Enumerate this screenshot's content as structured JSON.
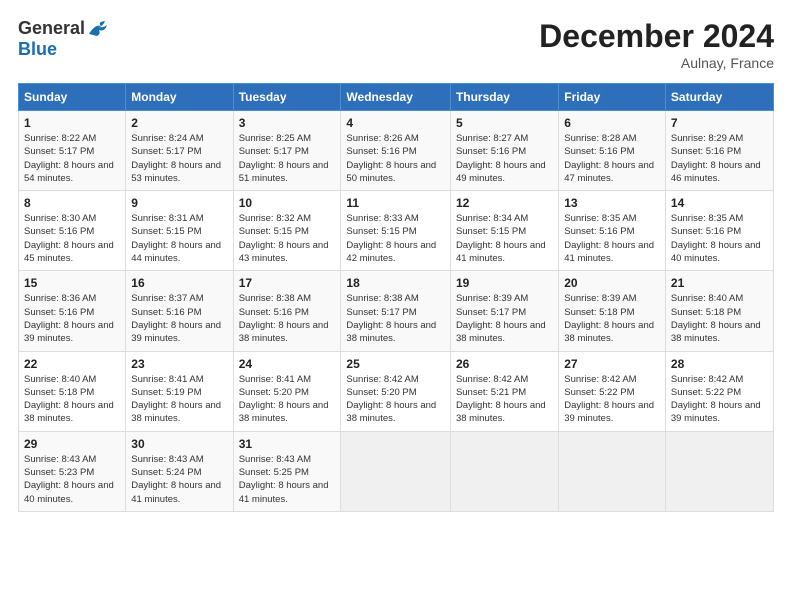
{
  "header": {
    "logo_general": "General",
    "logo_blue": "Blue",
    "title": "December 2024",
    "location": "Aulnay, France"
  },
  "calendar": {
    "days_of_week": [
      "Sunday",
      "Monday",
      "Tuesday",
      "Wednesday",
      "Thursday",
      "Friday",
      "Saturday"
    ],
    "weeks": [
      [
        {
          "day": "1",
          "sunrise": "8:22 AM",
          "sunset": "5:17 PM",
          "daylight": "8 hours and 54 minutes."
        },
        {
          "day": "2",
          "sunrise": "8:24 AM",
          "sunset": "5:17 PM",
          "daylight": "8 hours and 53 minutes."
        },
        {
          "day": "3",
          "sunrise": "8:25 AM",
          "sunset": "5:17 PM",
          "daylight": "8 hours and 51 minutes."
        },
        {
          "day": "4",
          "sunrise": "8:26 AM",
          "sunset": "5:16 PM",
          "daylight": "8 hours and 50 minutes."
        },
        {
          "day": "5",
          "sunrise": "8:27 AM",
          "sunset": "5:16 PM",
          "daylight": "8 hours and 49 minutes."
        },
        {
          "day": "6",
          "sunrise": "8:28 AM",
          "sunset": "5:16 PM",
          "daylight": "8 hours and 47 minutes."
        },
        {
          "day": "7",
          "sunrise": "8:29 AM",
          "sunset": "5:16 PM",
          "daylight": "8 hours and 46 minutes."
        }
      ],
      [
        {
          "day": "8",
          "sunrise": "8:30 AM",
          "sunset": "5:16 PM",
          "daylight": "8 hours and 45 minutes."
        },
        {
          "day": "9",
          "sunrise": "8:31 AM",
          "sunset": "5:15 PM",
          "daylight": "8 hours and 44 minutes."
        },
        {
          "day": "10",
          "sunrise": "8:32 AM",
          "sunset": "5:15 PM",
          "daylight": "8 hours and 43 minutes."
        },
        {
          "day": "11",
          "sunrise": "8:33 AM",
          "sunset": "5:15 PM",
          "daylight": "8 hours and 42 minutes."
        },
        {
          "day": "12",
          "sunrise": "8:34 AM",
          "sunset": "5:15 PM",
          "daylight": "8 hours and 41 minutes."
        },
        {
          "day": "13",
          "sunrise": "8:35 AM",
          "sunset": "5:16 PM",
          "daylight": "8 hours and 41 minutes."
        },
        {
          "day": "14",
          "sunrise": "8:35 AM",
          "sunset": "5:16 PM",
          "daylight": "8 hours and 40 minutes."
        }
      ],
      [
        {
          "day": "15",
          "sunrise": "8:36 AM",
          "sunset": "5:16 PM",
          "daylight": "8 hours and 39 minutes."
        },
        {
          "day": "16",
          "sunrise": "8:37 AM",
          "sunset": "5:16 PM",
          "daylight": "8 hours and 39 minutes."
        },
        {
          "day": "17",
          "sunrise": "8:38 AM",
          "sunset": "5:16 PM",
          "daylight": "8 hours and 38 minutes."
        },
        {
          "day": "18",
          "sunrise": "8:38 AM",
          "sunset": "5:17 PM",
          "daylight": "8 hours and 38 minutes."
        },
        {
          "day": "19",
          "sunrise": "8:39 AM",
          "sunset": "5:17 PM",
          "daylight": "8 hours and 38 minutes."
        },
        {
          "day": "20",
          "sunrise": "8:39 AM",
          "sunset": "5:18 PM",
          "daylight": "8 hours and 38 minutes."
        },
        {
          "day": "21",
          "sunrise": "8:40 AM",
          "sunset": "5:18 PM",
          "daylight": "8 hours and 38 minutes."
        }
      ],
      [
        {
          "day": "22",
          "sunrise": "8:40 AM",
          "sunset": "5:18 PM",
          "daylight": "8 hours and 38 minutes."
        },
        {
          "day": "23",
          "sunrise": "8:41 AM",
          "sunset": "5:19 PM",
          "daylight": "8 hours and 38 minutes."
        },
        {
          "day": "24",
          "sunrise": "8:41 AM",
          "sunset": "5:20 PM",
          "daylight": "8 hours and 38 minutes."
        },
        {
          "day": "25",
          "sunrise": "8:42 AM",
          "sunset": "5:20 PM",
          "daylight": "8 hours and 38 minutes."
        },
        {
          "day": "26",
          "sunrise": "8:42 AM",
          "sunset": "5:21 PM",
          "daylight": "8 hours and 38 minutes."
        },
        {
          "day": "27",
          "sunrise": "8:42 AM",
          "sunset": "5:22 PM",
          "daylight": "8 hours and 39 minutes."
        },
        {
          "day": "28",
          "sunrise": "8:42 AM",
          "sunset": "5:22 PM",
          "daylight": "8 hours and 39 minutes."
        }
      ],
      [
        {
          "day": "29",
          "sunrise": "8:43 AM",
          "sunset": "5:23 PM",
          "daylight": "8 hours and 40 minutes."
        },
        {
          "day": "30",
          "sunrise": "8:43 AM",
          "sunset": "5:24 PM",
          "daylight": "8 hours and 41 minutes."
        },
        {
          "day": "31",
          "sunrise": "8:43 AM",
          "sunset": "5:25 PM",
          "daylight": "8 hours and 41 minutes."
        },
        null,
        null,
        null,
        null
      ]
    ]
  }
}
